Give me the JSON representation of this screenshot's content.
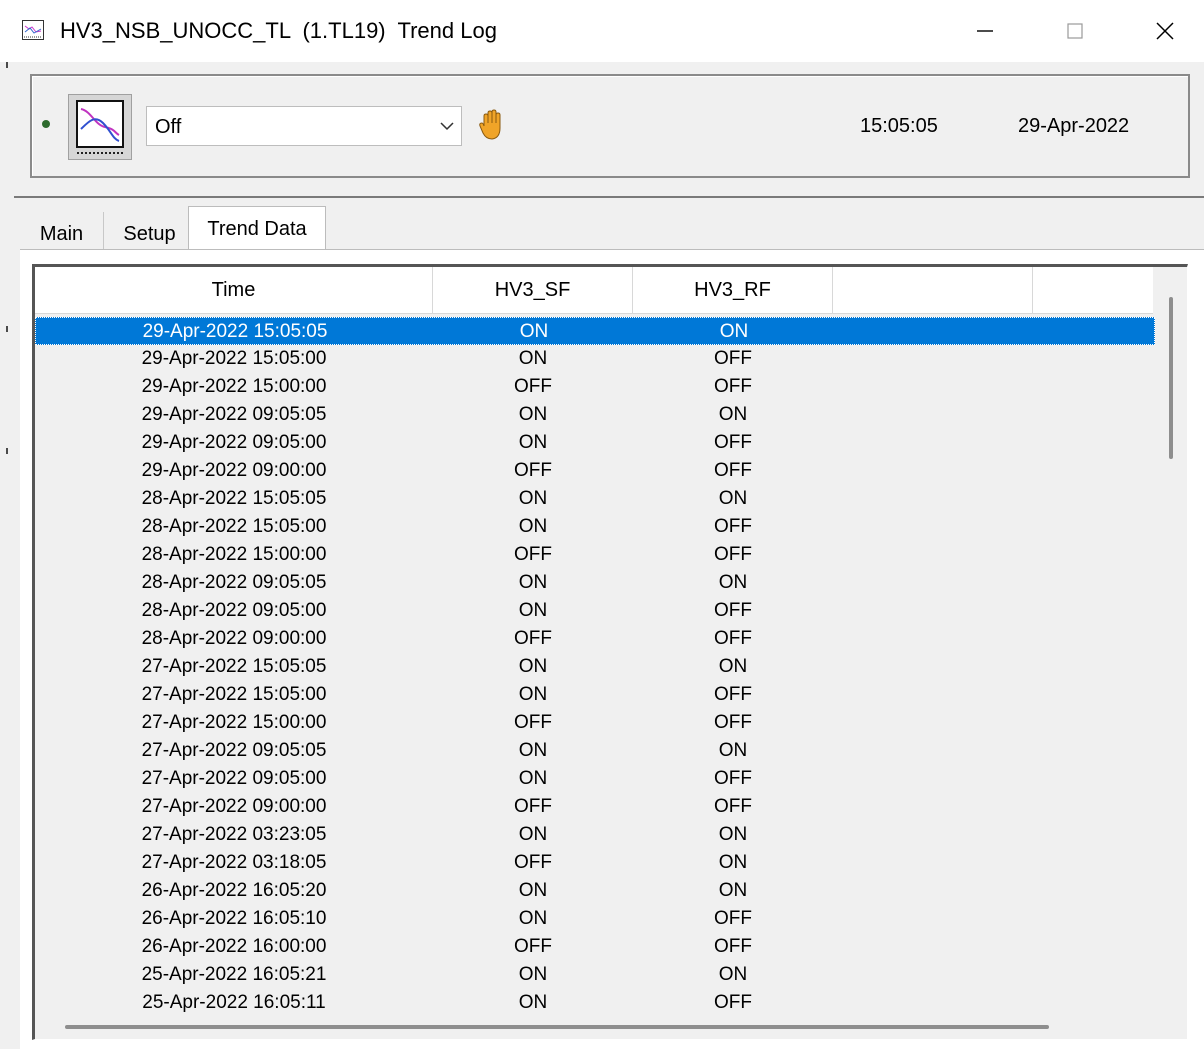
{
  "window": {
    "title": "HV3_NSB_UNOCC_TL  (1.TL19)  Trend Log",
    "app_icon": "trend-log-app-icon",
    "minimize": "window-minimize-icon",
    "maximize": "window-maximize-icon",
    "close": "window-close-icon"
  },
  "header": {
    "status_icon": "status-dot-icon",
    "trend_icon": "trend-chart-icon",
    "mode": {
      "selected": "Off"
    },
    "override_icon": "hand-icon",
    "time": "15:05:05",
    "date": "29-Apr-2022",
    "colors": {
      "status_dot": "#2d6b2d",
      "hand": "#e8a020"
    }
  },
  "tabs": [
    {
      "label": "Main",
      "active": false
    },
    {
      "label": "Setup",
      "active": false
    },
    {
      "label": "Trend Data",
      "active": true
    }
  ],
  "table": {
    "columns": [
      "Time",
      "HV3_SF",
      "HV3_RF",
      ""
    ],
    "selected_row_index": 0,
    "selection_color": "#0078d7",
    "rows": [
      {
        "time": "29-Apr-2022  15:05:05",
        "sf": "ON",
        "rf": "ON"
      },
      {
        "time": "29-Apr-2022  15:05:00",
        "sf": "ON",
        "rf": "OFF"
      },
      {
        "time": "29-Apr-2022  15:00:00",
        "sf": "OFF",
        "rf": "OFF"
      },
      {
        "time": "29-Apr-2022  09:05:05",
        "sf": "ON",
        "rf": "ON"
      },
      {
        "time": "29-Apr-2022  09:05:00",
        "sf": "ON",
        "rf": "OFF"
      },
      {
        "time": "29-Apr-2022  09:00:00",
        "sf": "OFF",
        "rf": "OFF"
      },
      {
        "time": "28-Apr-2022  15:05:05",
        "sf": "ON",
        "rf": "ON"
      },
      {
        "time": "28-Apr-2022  15:05:00",
        "sf": "ON",
        "rf": "OFF"
      },
      {
        "time": "28-Apr-2022  15:00:00",
        "sf": "OFF",
        "rf": "OFF"
      },
      {
        "time": "28-Apr-2022  09:05:05",
        "sf": "ON",
        "rf": "ON"
      },
      {
        "time": "28-Apr-2022  09:05:00",
        "sf": "ON",
        "rf": "OFF"
      },
      {
        "time": "28-Apr-2022  09:00:00",
        "sf": "OFF",
        "rf": "OFF"
      },
      {
        "time": "27-Apr-2022  15:05:05",
        "sf": "ON",
        "rf": "ON"
      },
      {
        "time": "27-Apr-2022  15:05:00",
        "sf": "ON",
        "rf": "OFF"
      },
      {
        "time": "27-Apr-2022  15:00:00",
        "sf": "OFF",
        "rf": "OFF"
      },
      {
        "time": "27-Apr-2022  09:05:05",
        "sf": "ON",
        "rf": "ON"
      },
      {
        "time": "27-Apr-2022  09:05:00",
        "sf": "ON",
        "rf": "OFF"
      },
      {
        "time": "27-Apr-2022  09:00:00",
        "sf": "OFF",
        "rf": "OFF"
      },
      {
        "time": "27-Apr-2022  03:23:05",
        "sf": "ON",
        "rf": "ON"
      },
      {
        "time": "27-Apr-2022  03:18:05",
        "sf": "OFF",
        "rf": "ON"
      },
      {
        "time": "26-Apr-2022  16:05:20",
        "sf": "ON",
        "rf": "ON"
      },
      {
        "time": "26-Apr-2022  16:05:10",
        "sf": "ON",
        "rf": "OFF"
      },
      {
        "time": "26-Apr-2022  16:00:00",
        "sf": "OFF",
        "rf": "OFF"
      },
      {
        "time": "25-Apr-2022  16:05:21",
        "sf": "ON",
        "rf": "ON"
      },
      {
        "time": "25-Apr-2022  16:05:11",
        "sf": "ON",
        "rf": "OFF"
      }
    ]
  }
}
